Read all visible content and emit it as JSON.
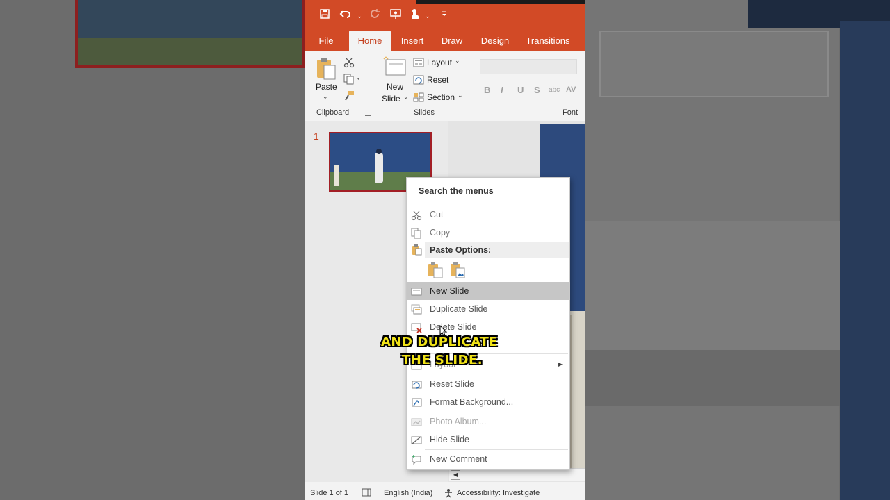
{
  "qat": {
    "icons": [
      "save-icon",
      "undo-icon",
      "redo-icon",
      "presenter-icon",
      "touch-mode-icon",
      "customize-icon"
    ]
  },
  "tabs": [
    "File",
    "Home",
    "Insert",
    "Draw",
    "Design",
    "Transitions"
  ],
  "ribbon": {
    "paste": "Paste",
    "clipboard": "Clipboard",
    "new_slide_line1": "New",
    "new_slide_line2": "Slide",
    "layout": "Layout",
    "reset": "Reset",
    "section": "Section",
    "slides": "Slides",
    "font": "Font",
    "font_buttons": [
      "B",
      "I",
      "U",
      "S",
      "abc",
      "AV"
    ]
  },
  "thumbnail": {
    "number": "1"
  },
  "context_menu": {
    "search": "Search the menus",
    "cut": "Cut",
    "copy": "Copy",
    "paste_options": "Paste Options:",
    "new_slide": "New Slide",
    "duplicate_slide": "Duplicate Slide",
    "delete_slide": "Delete Slide",
    "layout": "Layout",
    "reset_slide": "Reset Slide",
    "format_background": "Format Background...",
    "photo_album": "Photo Album...",
    "hide_slide": "Hide Slide",
    "new_comment": "New Comment"
  },
  "caption": {
    "line1": "AND DUPLICATE",
    "line2": "THE SLIDE."
  },
  "status": {
    "slide_count": "Slide 1 of 1",
    "language": "English (India)",
    "accessibility": "Accessibility: Investigate"
  },
  "colors": {
    "accent": "#d24a26",
    "thumb_border": "#a31f26"
  }
}
